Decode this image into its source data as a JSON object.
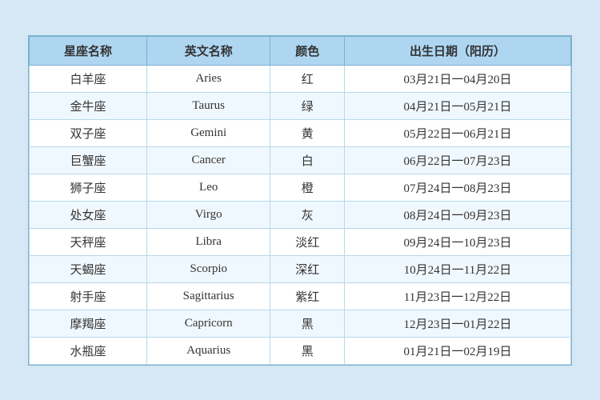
{
  "table": {
    "headers": [
      "星座名称",
      "英文名称",
      "颜色",
      "出生日期（阳历）"
    ],
    "rows": [
      [
        "白羊座",
        "Aries",
        "红",
        "03月21日一04月20日"
      ],
      [
        "金牛座",
        "Taurus",
        "绿",
        "04月21日一05月21日"
      ],
      [
        "双子座",
        "Gemini",
        "黄",
        "05月22日一06月21日"
      ],
      [
        "巨蟹座",
        "Cancer",
        "白",
        "06月22日一07月23日"
      ],
      [
        "狮子座",
        "Leo",
        "橙",
        "07月24日一08月23日"
      ],
      [
        "处女座",
        "Virgo",
        "灰",
        "08月24日一09月23日"
      ],
      [
        "天秤座",
        "Libra",
        "淡红",
        "09月24日一10月23日"
      ],
      [
        "天蝎座",
        "Scorpio",
        "深红",
        "10月24日一11月22日"
      ],
      [
        "射手座",
        "Sagittarius",
        "紫红",
        "11月23日一12月22日"
      ],
      [
        "摩羯座",
        "Capricorn",
        "黑",
        "12月23日一01月22日"
      ],
      [
        "水瓶座",
        "Aquarius",
        "黑",
        "01月21日一02月19日"
      ]
    ]
  }
}
